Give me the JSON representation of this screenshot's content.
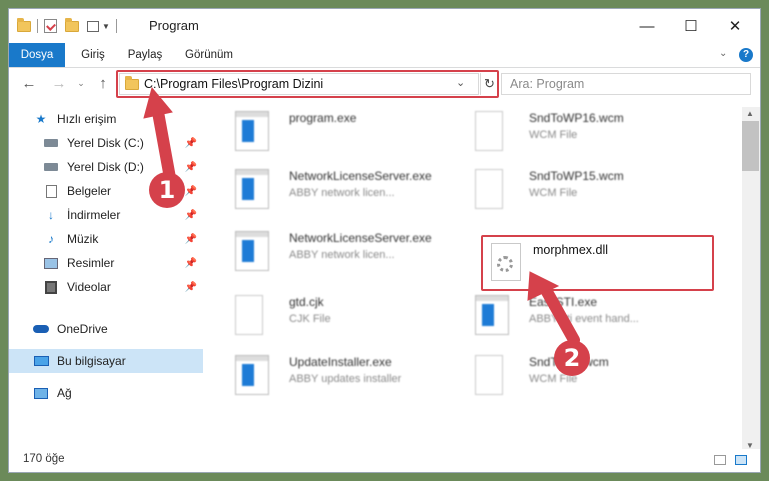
{
  "window": {
    "title": "Program",
    "minimize": "—",
    "maximize": "☐",
    "close": "✕"
  },
  "ribbon": {
    "tabs": [
      "Dosya",
      "Giriş",
      "Paylaş",
      "Görünüm"
    ]
  },
  "address": {
    "path": "C:\\Program Files\\Program Dizini",
    "search_placeholder": "Ara: Program"
  },
  "sidebar": {
    "items": [
      {
        "label": "Hızlı erişim",
        "icon": "star-icon"
      },
      {
        "label": "Yerel Disk (C:)",
        "icon": "drive-icon"
      },
      {
        "label": "Yerel Disk (D:)",
        "icon": "drive-icon"
      },
      {
        "label": "Belgeler",
        "icon": "document-icon"
      },
      {
        "label": "İndirmeler",
        "icon": "download-icon"
      },
      {
        "label": "Müzik",
        "icon": "music-icon"
      },
      {
        "label": "Resimler",
        "icon": "pictures-icon"
      },
      {
        "label": "Videolar",
        "icon": "video-icon"
      },
      {
        "label": "OneDrive",
        "icon": "cloud-icon"
      },
      {
        "label": "Bu bilgisayar",
        "icon": "computer-icon"
      },
      {
        "label": "Ağ",
        "icon": "network-icon"
      }
    ]
  },
  "files": [
    {
      "name": "program.exe",
      "sub": ""
    },
    {
      "name": "SndToWP16.wcm",
      "sub": "WCM File"
    },
    {
      "name": "NetworkLicenseServer.exe",
      "sub": "ABBY network licen..."
    },
    {
      "name": "SndToWP15.wcm",
      "sub": "WCM File"
    },
    {
      "name": "NetworkLicenseServer.exe",
      "sub": "ABBY network licen..."
    },
    {
      "name": "morphmex.dll",
      "sub": ""
    },
    {
      "name": "gtd.cjk",
      "sub": "CJK File"
    },
    {
      "name": "EasySTI.exe",
      "sub": "ABBY sti event hand..."
    },
    {
      "name": "UpdateInstaller.exe",
      "sub": "ABBY updates installer"
    },
    {
      "name": "SndToWP.wcm",
      "sub": "WCM File"
    }
  ],
  "status": {
    "count": "170 öğe"
  },
  "callouts": [
    "1",
    "2"
  ],
  "colors": {
    "accent": "#1979ca",
    "highlight": "#d5414b"
  }
}
